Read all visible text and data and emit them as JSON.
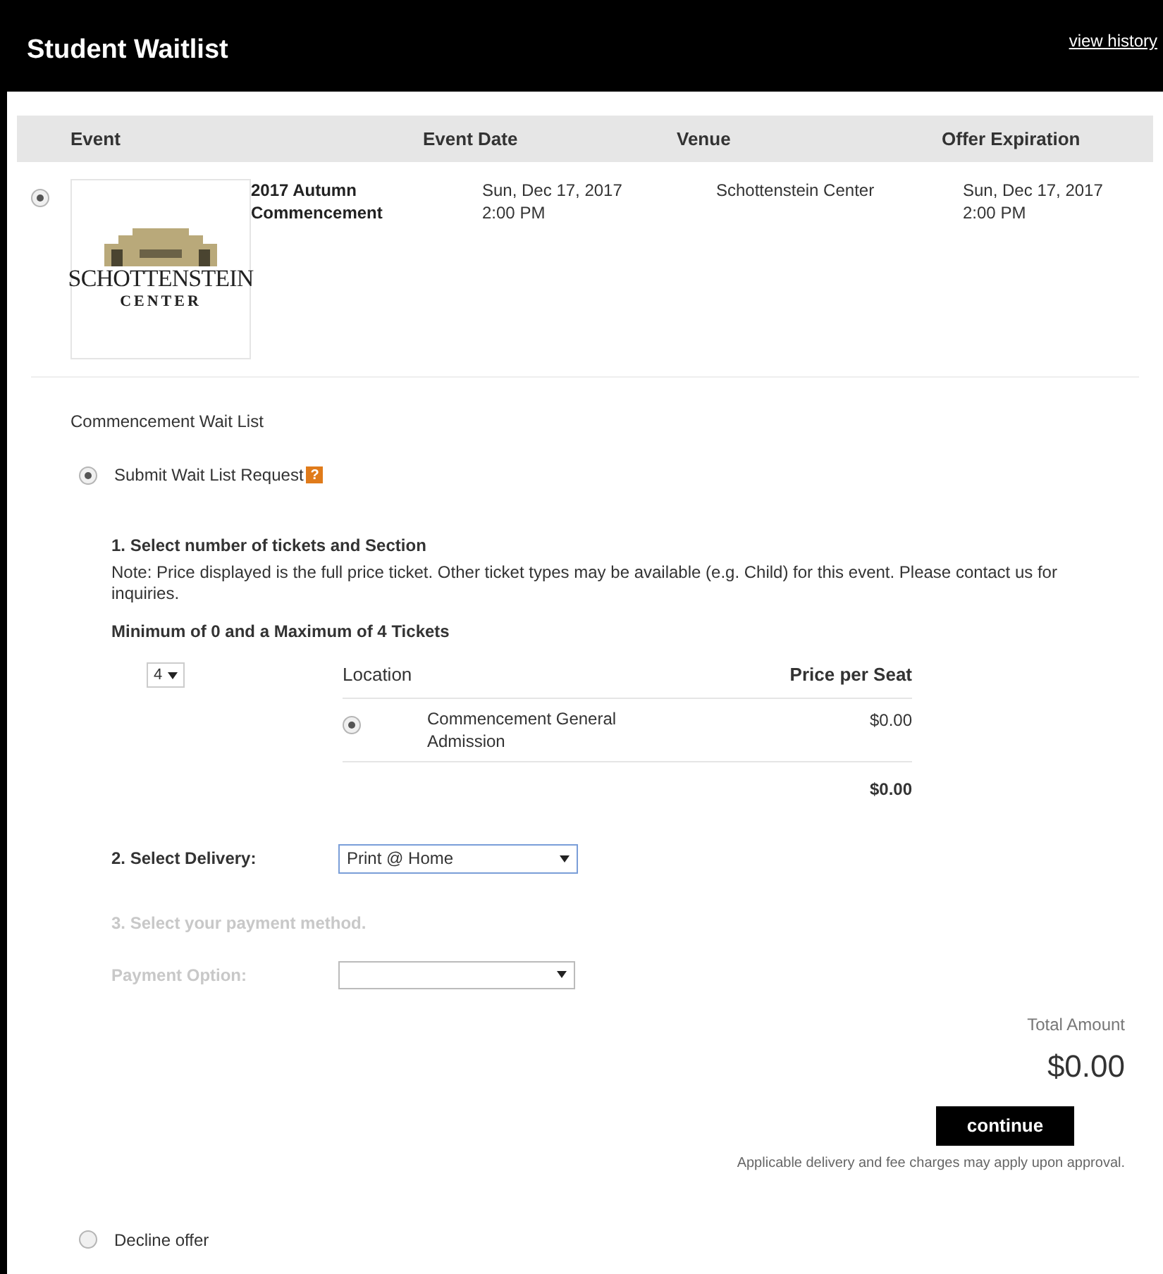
{
  "header": {
    "title": "Student Waitlist",
    "link": "view history"
  },
  "events_table": {
    "columns": [
      "Event",
      "Event Date",
      "Venue",
      "Offer Expiration"
    ],
    "rows": [
      {
        "selected": true,
        "logo": {
          "name": "SCHOTTENSTEIN",
          "sub": "CENTER"
        },
        "event": "2017 Autumn Commencement",
        "date": [
          "Sun, Dec 17, 2017",
          "2:00 PM"
        ],
        "venue": "Schottenstein Center",
        "expiration": [
          "Sun, Dec 17, 2017",
          "2:00 PM"
        ]
      }
    ]
  },
  "section_title": "Commencement Wait List",
  "options": [
    {
      "label": "Submit Wait List Request",
      "selected": true,
      "help": "?"
    },
    {
      "label": "Decline offer",
      "selected": false
    }
  ],
  "step1": {
    "title": "1. Select number of tickets and Section",
    "note": "Note: Price displayed is the full price ticket. Other ticket types may be available (e.g. Child) for this event. Please contact us for inquiries.",
    "limits": "Minimum of 0 and a Maximum of 4 Tickets",
    "quantity": "4",
    "columns": [
      "Location",
      "Price per Seat"
    ],
    "locations": [
      {
        "name": "Commencement General Admission",
        "price": "$0.00",
        "selected": true
      }
    ],
    "subtotal": "$0.00"
  },
  "step2": {
    "label": "2. Select Delivery:",
    "value": "Print @ Home"
  },
  "step3": {
    "title": "3. Select your payment method.",
    "label": "Payment Option:",
    "disabled": true
  },
  "total": {
    "label": "Total Amount",
    "amount": "$0.00",
    "button": "continue",
    "note": "Applicable delivery and fee charges may apply upon approval."
  }
}
